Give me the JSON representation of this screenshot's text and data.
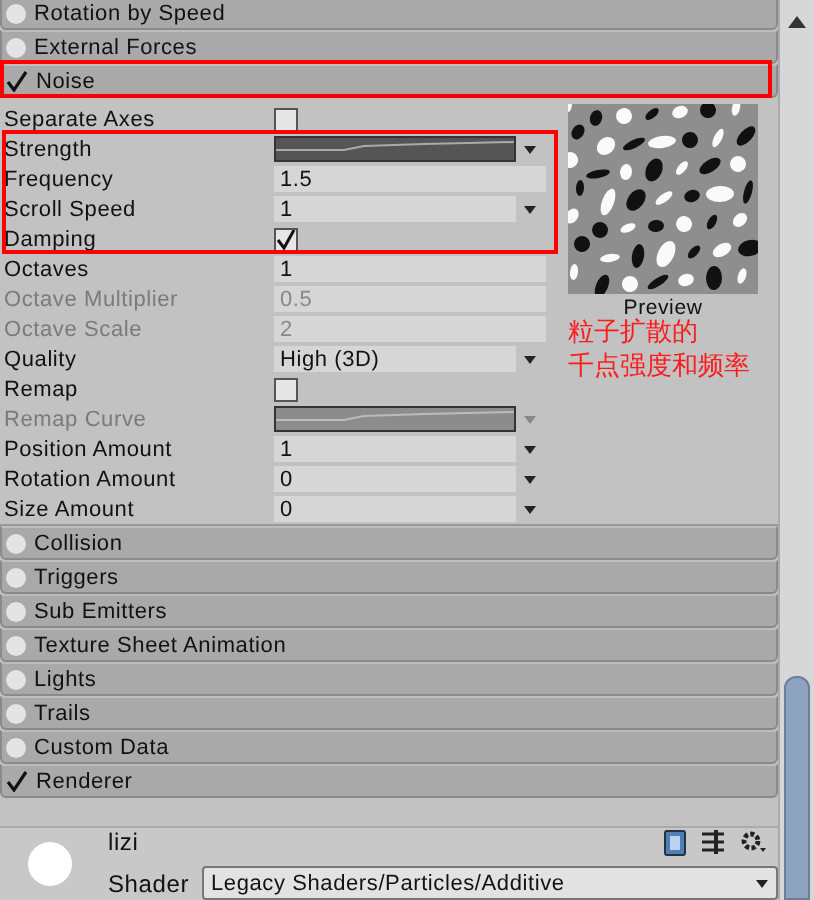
{
  "modules_top": [
    {
      "label": "Rotation by Speed",
      "enabled": false
    },
    {
      "label": "External Forces",
      "enabled": false
    },
    {
      "label": "Noise",
      "enabled": true
    }
  ],
  "noise": {
    "preview_label": "Preview",
    "params": [
      {
        "label": "Separate Axes",
        "kind": "checkbox",
        "checked": false,
        "disabled": false
      },
      {
        "label": "Strength",
        "kind": "curve",
        "disabled": false
      },
      {
        "label": "Frequency",
        "kind": "field",
        "value": "1.5",
        "disabled": false
      },
      {
        "label": "Scroll Speed",
        "kind": "dropdown",
        "value": "1",
        "disabled": false
      },
      {
        "label": "Damping",
        "kind": "checkbox",
        "checked": true,
        "disabled": false
      },
      {
        "label": "Octaves",
        "kind": "field",
        "value": "1",
        "disabled": false
      },
      {
        "label": "Octave Multiplier",
        "kind": "field",
        "value": "0.5",
        "disabled": true
      },
      {
        "label": "Octave Scale",
        "kind": "field",
        "value": "2",
        "disabled": true
      },
      {
        "label": "Quality",
        "kind": "dropdown",
        "value": "High (3D)",
        "disabled": false
      },
      {
        "label": "Remap",
        "kind": "checkbox",
        "checked": false,
        "disabled": false
      },
      {
        "label": "Remap Curve",
        "kind": "curve",
        "disabled": true
      },
      {
        "label": "Position Amount",
        "kind": "dropdown",
        "value": "1",
        "disabled": false
      },
      {
        "label": "Rotation Amount",
        "kind": "dropdown",
        "value": "0",
        "disabled": false
      },
      {
        "label": "Size Amount",
        "kind": "dropdown",
        "value": "0",
        "disabled": false
      }
    ]
  },
  "modules_bottom": [
    {
      "label": "Collision",
      "enabled": false
    },
    {
      "label": "Triggers",
      "enabled": false
    },
    {
      "label": "Sub Emitters",
      "enabled": false
    },
    {
      "label": "Texture Sheet Animation",
      "enabled": false
    },
    {
      "label": "Lights",
      "enabled": false
    },
    {
      "label": "Trails",
      "enabled": false
    },
    {
      "label": "Custom Data",
      "enabled": false
    },
    {
      "label": "Renderer",
      "enabled": true
    }
  ],
  "material": {
    "name": "lizi",
    "shader_label": "Shader",
    "shader": "Legacy Shaders/Particles/Additive"
  },
  "annotation": {
    "lines": [
      "粒子扩散的",
      "千点强度和频率"
    ]
  }
}
